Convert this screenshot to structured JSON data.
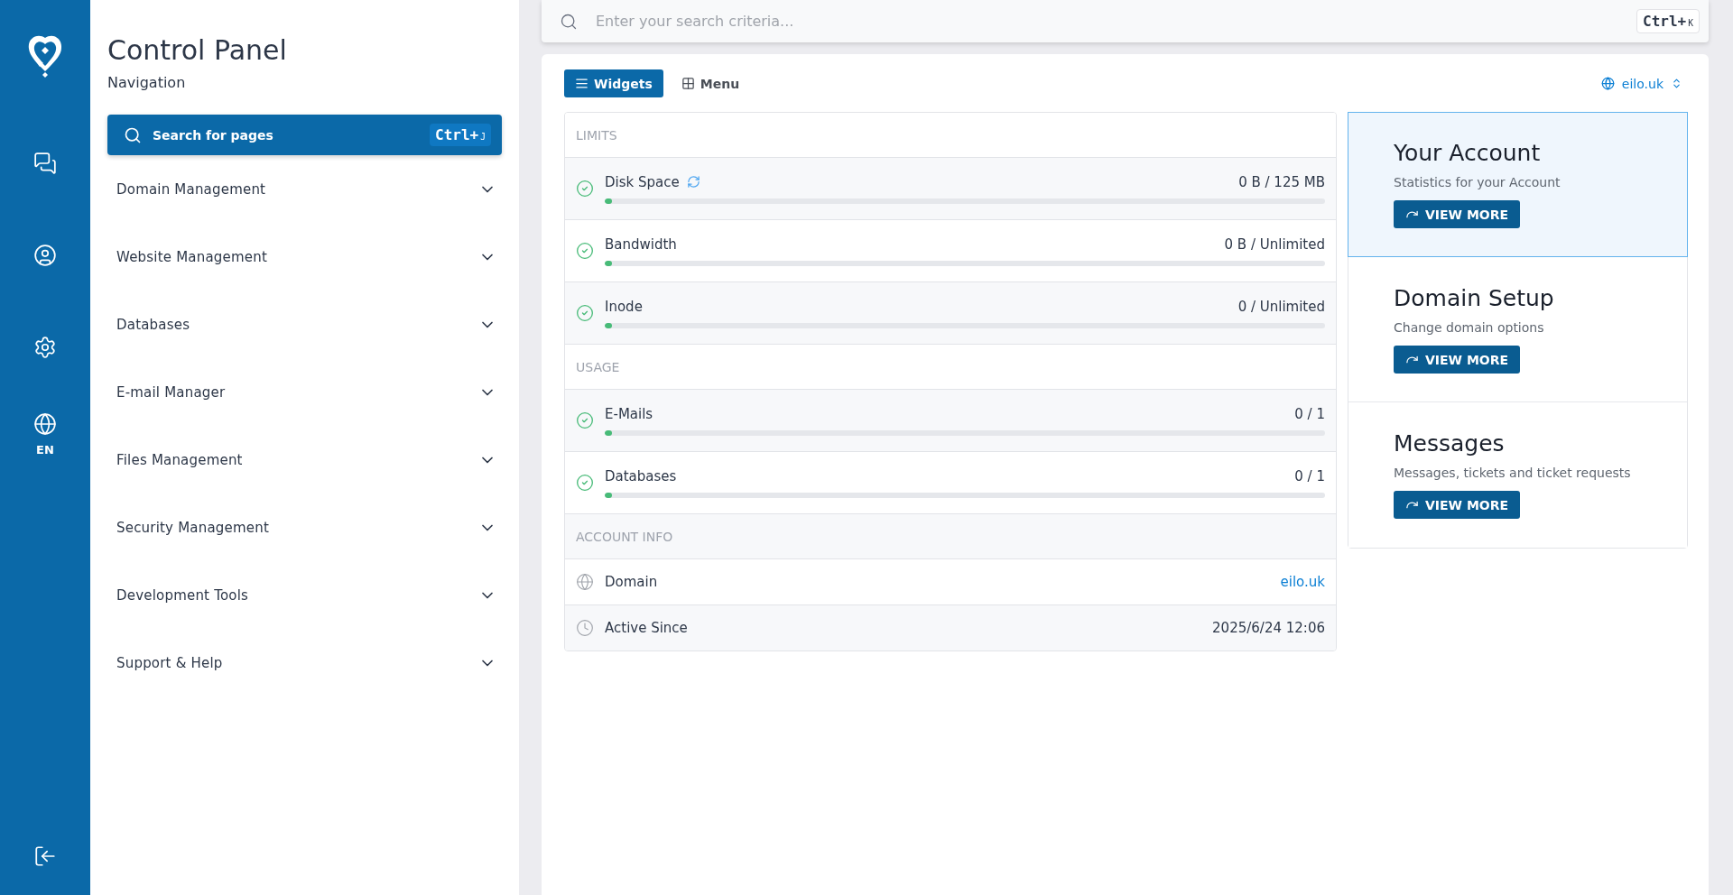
{
  "rail": {
    "language": "EN"
  },
  "sidebar": {
    "title": "Control Panel",
    "subtitle": "Navigation",
    "search": {
      "label": "Search for pages",
      "shortcut": {
        "modifier": "Ctrl+",
        "key": "J"
      }
    },
    "items": [
      {
        "label": "Domain Management",
        "expanded": false
      },
      {
        "label": "Website Management",
        "expanded": false
      },
      {
        "label": "Databases",
        "expanded": false
      },
      {
        "label": "E-mail Manager",
        "expanded": false
      },
      {
        "label": "Files Management",
        "expanded": false
      },
      {
        "label": "Security Management",
        "expanded": false
      },
      {
        "label": "Development Tools",
        "expanded": false
      },
      {
        "label": "Support & Help",
        "expanded": false
      }
    ]
  },
  "topbar": {
    "search": {
      "placeholder": "Enter your search criteria...",
      "shortcut": {
        "modifier": "Ctrl+",
        "key": "K"
      }
    }
  },
  "view_tabs": [
    {
      "label": "Widgets",
      "kind": "list",
      "selected": true
    },
    {
      "label": "Menu",
      "kind": "grid",
      "selected": false
    }
  ],
  "domain_picker": "eilo.uk",
  "sections": [
    {
      "title": "LIMITS",
      "rows": [
        {
          "kind": "meter",
          "label": "Disk Space",
          "refresh": true,
          "value": "0 B / 125 MB",
          "level": 0
        },
        {
          "kind": "meter",
          "label": "Bandwidth",
          "refresh": false,
          "value": "0 B / Unlimited",
          "level": 0
        },
        {
          "kind": "meter",
          "label": "Inode",
          "refresh": false,
          "value": "0 / Unlimited",
          "level": 0
        }
      ]
    },
    {
      "title": "USAGE",
      "rows": [
        {
          "kind": "meter",
          "label": "E-Mails",
          "refresh": false,
          "value": "0 / 1",
          "level": 0
        },
        {
          "kind": "meter",
          "label": "Databases",
          "refresh": false,
          "value": "0 / 1",
          "level": 0
        }
      ]
    },
    {
      "title": "ACCOUNT INFO",
      "rows": [
        {
          "kind": "link",
          "label": "Domain",
          "value": "eilo.uk"
        },
        {
          "kind": "date",
          "label": "Active Since",
          "value": "2025/6/24 12:06"
        }
      ]
    }
  ],
  "cards": [
    {
      "title": "Your Account",
      "subtitle": "Statistics for your Account",
      "button": "VIEW MORE",
      "selected": true
    },
    {
      "title": "Domain Setup",
      "subtitle": "Change domain options",
      "button": "VIEW MORE",
      "selected": false
    },
    {
      "title": "Messages",
      "subtitle": "Messages, tickets and ticket requests",
      "button": "VIEW MORE",
      "selected": false
    }
  ]
}
